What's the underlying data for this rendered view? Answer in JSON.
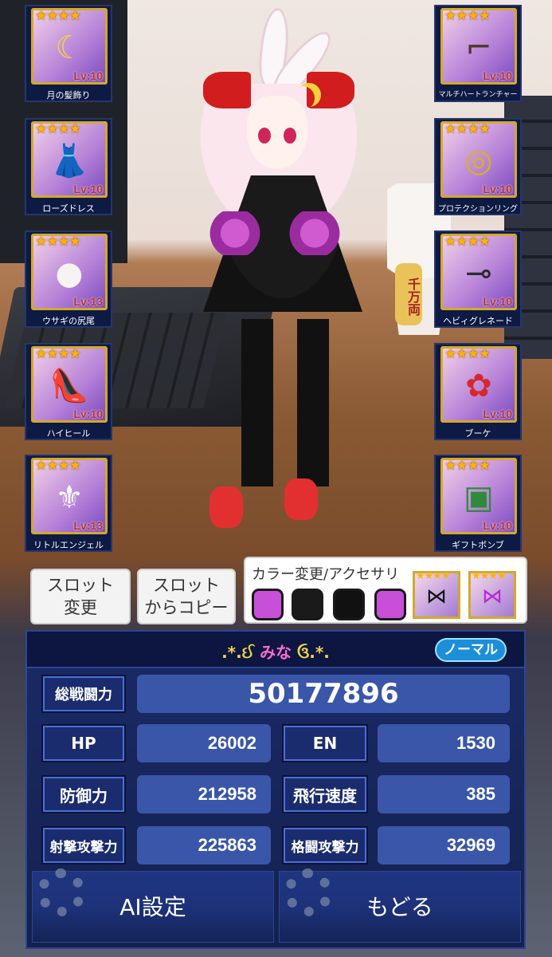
{
  "equipment_left": [
    {
      "name": "月の髪飾り",
      "level": "Lv:10",
      "stars": "★★★★",
      "icon": "crescent-moon-icon"
    },
    {
      "name": "ローズドレス",
      "level": "Lv:10",
      "stars": "★★★★",
      "icon": "red-dress-icon"
    },
    {
      "name": "ウサギの尻尾",
      "level": "Lv:13",
      "stars": "★★★★",
      "icon": "bunny-tail-icon"
    },
    {
      "name": "ハイヒール",
      "level": "Lv:10",
      "stars": "★★★★",
      "icon": "high-heels-icon"
    },
    {
      "name": "リトルエンジェル",
      "level": "Lv:13",
      "stars": "★★★★",
      "icon": "angel-wings-icon"
    }
  ],
  "equipment_right": [
    {
      "name": "マルチハートランチャー",
      "level": "Lv:10",
      "stars": "★★★★",
      "icon": "launcher-gun-icon"
    },
    {
      "name": "プロテクションリング",
      "level": "Lv:10",
      "stars": "★★★★",
      "icon": "ring-icon"
    },
    {
      "name": "ヘビィグレネード",
      "level": "Lv:10",
      "stars": "★★★★",
      "icon": "grenade-icon"
    },
    {
      "name": "ブーケ",
      "level": "Lv:10",
      "stars": "★★★★",
      "icon": "bouquet-icon"
    },
    {
      "name": "ギフトボンブ",
      "level": "Lv:10",
      "stars": "★★★★",
      "icon": "gift-bomb-icon"
    }
  ],
  "slot_buttons": {
    "change": "スロット\n変更",
    "copy": "スロット\nからコピー"
  },
  "color_panel": {
    "title": "カラー変更/アクセサリ",
    "swatches": [
      "#c850d8",
      "#1a1a1a",
      "#111111",
      "#c850d8"
    ],
    "accessories": [
      {
        "stars": "★★★★",
        "icon": "black-bow-icon"
      },
      {
        "stars": "★★★★",
        "icon": "purple-bow-icon"
      }
    ]
  },
  "status": {
    "name_prefix": ".*.ઈ",
    "name": " みな ",
    "name_suffix": "ઉ.*.",
    "mode_badge": "ノーマル",
    "total_power_label": "総戦闘力",
    "total_power": "50177896",
    "stats": [
      {
        "label": "HP",
        "value": "26002"
      },
      {
        "label": "EN",
        "value": "1530"
      },
      {
        "label": "防御力",
        "value": "212958"
      },
      {
        "label": "飛行速度",
        "value": "385"
      },
      {
        "label": "射撃攻撃力",
        "value": "225863"
      },
      {
        "label": "格闘攻撃力",
        "value": "32969"
      }
    ]
  },
  "actions": {
    "ai_settings": "AI設定",
    "back": "もどる"
  },
  "cat_sign_text": "千万両"
}
